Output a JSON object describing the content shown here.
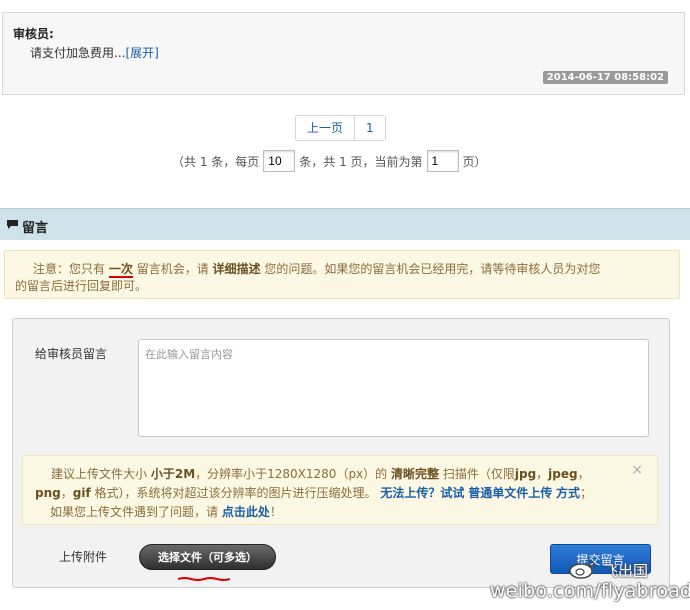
{
  "review": {
    "reviewer_label": "审核员:",
    "message": "请支付加急费用...",
    "expand_link": "[展开]",
    "timestamp": "2014-06-17 08:58:02"
  },
  "pagination": {
    "prev_label": "上一页",
    "page_1_label": "1",
    "info_prefix": "（共 1 条，每页",
    "per_page_value": "10",
    "info_middle": "条，共 1 页，当前为第",
    "current_page_value": "1",
    "info_suffix": "页）"
  },
  "section": {
    "title": "留言",
    "icon": "chat-bubble-icon"
  },
  "notice": {
    "p1": "注意：您只有",
    "b1": "一次",
    "p2": "留言机会，请",
    "b2": "详细描述",
    "p3": "您的问题。如果您的留言机会已经用完，请等待审核人员为对您",
    "line2": "的留言后进行回复即可。"
  },
  "form": {
    "message_label": "给审核员留言",
    "message_placeholder": "在此输入留言内容",
    "upload_notice": {
      "a1": "建议上传文件大小",
      "a2": "小于2M",
      "a3": "，分辨率小于1280X1280（px）的",
      "a4": "清晰完整",
      "a5": "扫描件（仅限",
      "a6": "jpg",
      "a7": "，",
      "a8": "jpeg",
      "a9": "，",
      "b1": "png",
      "b2": "，",
      "b3": "gif",
      "b4": "格式），系统将对超过该分辨率的图片进行压缩处理。",
      "b5": "无法上传？试试",
      "b6": "普通单文件上传",
      "b7": "方式",
      "b8": "；",
      "c1": "如果您上传文件遇到了问题，请",
      "c2": "点击此处",
      "c3": "！",
      "close": "×"
    },
    "attach_label": "上传附件",
    "choose_file_label": "选择文件（可多选）",
    "submit_label": "提交留言"
  },
  "watermark": {
    "handle": "飞出国",
    "url": "weibo.com/flyabroad"
  },
  "colors": {
    "link": "#1a5fa8",
    "section_header": "#cfe2ea",
    "notice_bg": "#fcf8e3",
    "submit": "#1a6ac7"
  }
}
